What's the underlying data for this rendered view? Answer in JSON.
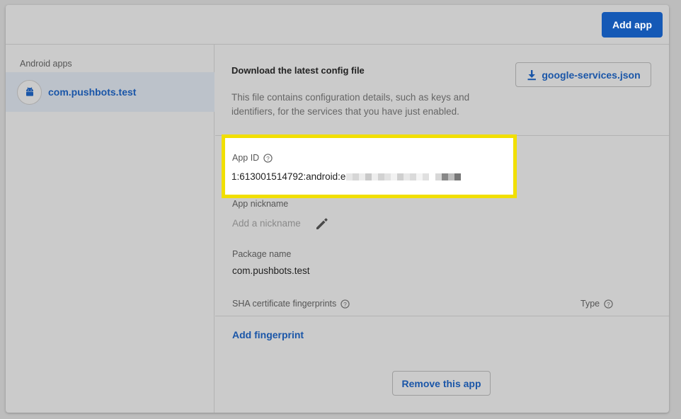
{
  "header": {
    "add_app_label": "Add app"
  },
  "sidebar": {
    "heading": "Android apps",
    "apps": [
      {
        "name": "com.pushbots.test",
        "icon": "android-icon"
      }
    ]
  },
  "config": {
    "title": "Download the latest config file",
    "description": "This file contains configuration details, such as keys and identifiers, for the services that you have just enabled.",
    "download_button": "google-services.json",
    "download_icon": "download-icon"
  },
  "app_id": {
    "label": "App ID",
    "value_prefix": "1:613001514792:android:e",
    "highlight_color": "#f1df00"
  },
  "nickname": {
    "label": "App nickname",
    "placeholder": "Add a nickname"
  },
  "package": {
    "label": "Package name",
    "value": "com.pushbots.test"
  },
  "sha": {
    "label": "SHA certificate fingerprints",
    "type_label": "Type"
  },
  "actions": {
    "add_fingerprint": "Add fingerprint",
    "remove_app": "Remove this app"
  },
  "colors": {
    "accent": "#1559b6",
    "link": "#1a56a8"
  }
}
